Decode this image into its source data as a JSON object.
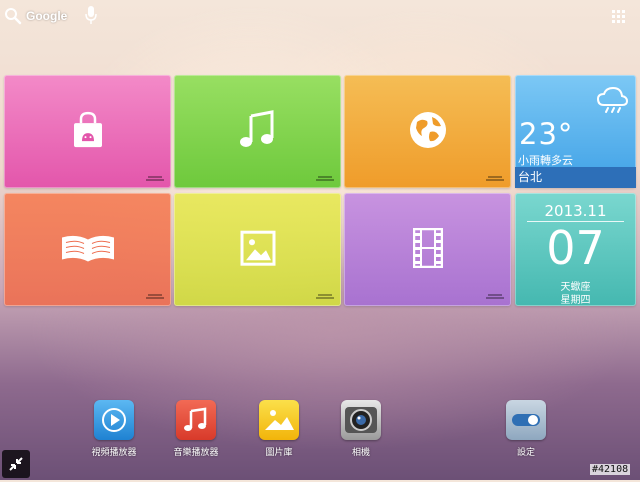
{
  "top_bar": {
    "search_label": "Google",
    "search_icon": "search-icon",
    "voice_icon": "microphone-icon",
    "apps_icon": "app-grid-icon"
  },
  "tiles": {
    "shop": {
      "icon": "shopping-bag-icon",
      "color": "#ec6cb9"
    },
    "music": {
      "icon": "music-note-icon",
      "color": "#82d44f"
    },
    "browser": {
      "icon": "globe-icon",
      "color": "#f2ac3e"
    },
    "books": {
      "icon": "open-book-icon",
      "color": "#f1785a"
    },
    "gallery": {
      "icon": "picture-icon",
      "color": "#dde04c"
    },
    "video": {
      "icon": "film-icon",
      "color": "#b882d8"
    }
  },
  "weather": {
    "temperature": "23°",
    "condition": "小雨轉多云",
    "city": "台北",
    "icon": "rain-cloud-icon",
    "color": "#57b2ec"
  },
  "date_widget": {
    "year_month": "2013.11",
    "day": "07",
    "zodiac": "天蠍座",
    "weekday": "星期四",
    "color": "#5ec7bf"
  },
  "dock": [
    {
      "label": "視頻播放器",
      "icon": "play-icon",
      "color": "#2f9be5"
    },
    {
      "label": "音樂播放器",
      "icon": "music-note-icon",
      "color": "#e84a3a"
    },
    {
      "label": "圖片庫",
      "icon": "landscape-icon",
      "color": "#f6c51c"
    },
    {
      "label": "相機",
      "icon": "camera-icon",
      "color": "#d0d0d0"
    },
    {
      "label": "設定",
      "icon": "settings-toggle-icon",
      "color": "#8aa6c2"
    }
  ],
  "watermark": "#42108"
}
